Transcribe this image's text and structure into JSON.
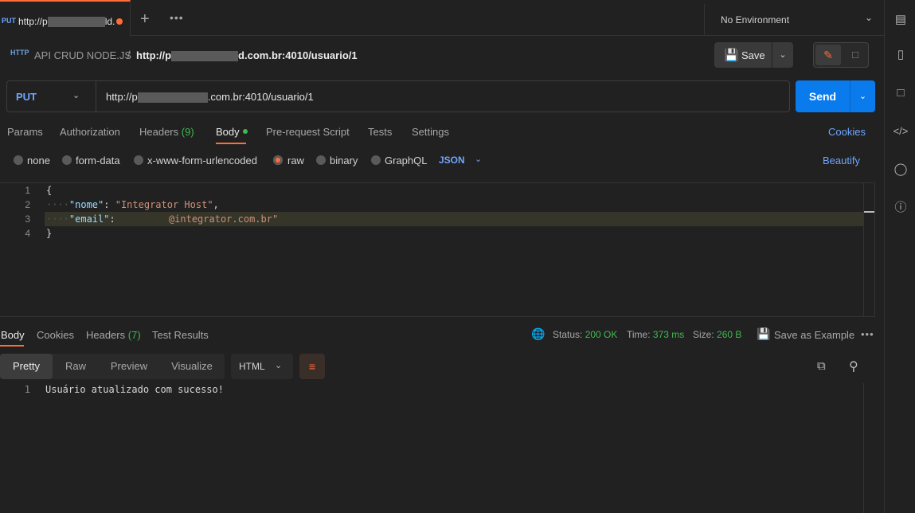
{
  "tabs": {
    "active": {
      "method": "PUT",
      "url_start": "http://p",
      "url_end": "ld."
    },
    "new_tab_glyph": "+",
    "more_glyph": "•••"
  },
  "environment": {
    "label": "No Environment"
  },
  "breadcrumb": {
    "collection": "API CRUD NODE.JS",
    "separator": "/",
    "request_start": "http://p",
    "request_end": "d.com.br:4010/usuario/1"
  },
  "toolbar": {
    "save_label": "Save"
  },
  "request": {
    "method": "PUT",
    "url_start": "http://p",
    "url_end": ".com.br:4010/usuario/1",
    "send_label": "Send"
  },
  "request_tabs": {
    "params": "Params",
    "authorization": "Authorization",
    "headers": "Headers",
    "headers_count": "(9)",
    "body": "Body",
    "pre_request": "Pre-request Script",
    "tests": "Tests",
    "settings": "Settings",
    "cookies": "Cookies"
  },
  "body_types": {
    "none": "none",
    "form_data": "form-data",
    "urlencoded": "x-www-form-urlencoded",
    "raw": "raw",
    "binary": "binary",
    "graphql": "GraphQL",
    "format": "JSON",
    "beautify": "Beautify"
  },
  "editor": {
    "line_numbers": [
      "1",
      "2",
      "3",
      "4"
    ],
    "open_brace": "{",
    "close_brace": "}",
    "key_nome": "\"nome\"",
    "val_nome": "\"Integrator Host\"",
    "key_email": "\"email\"",
    "val_email": "@integrator.com.br\"",
    "colon": ": ",
    "comma": ",",
    "indent": "····"
  },
  "response_tabs": {
    "body": "Body",
    "cookies": "Cookies",
    "headers": "Headers",
    "headers_count": "(7)",
    "test_results": "Test Results"
  },
  "response_meta": {
    "status_label": "Status:",
    "status_value": "200 OK",
    "time_label": "Time:",
    "time_value": "373 ms",
    "size_label": "Size:",
    "size_value": "260 B",
    "save_example": "Save as Example"
  },
  "response_view": {
    "pretty": "Pretty",
    "raw": "Raw",
    "preview": "Preview",
    "visualize": "Visualize",
    "language": "HTML"
  },
  "response_body": {
    "line_number": "1",
    "text": "Usuário atualizado com sucesso!"
  },
  "colors": {
    "accent": "#ff6c37",
    "primary": "#097bed",
    "success": "#3fb950",
    "method": "#6ea6ff"
  }
}
